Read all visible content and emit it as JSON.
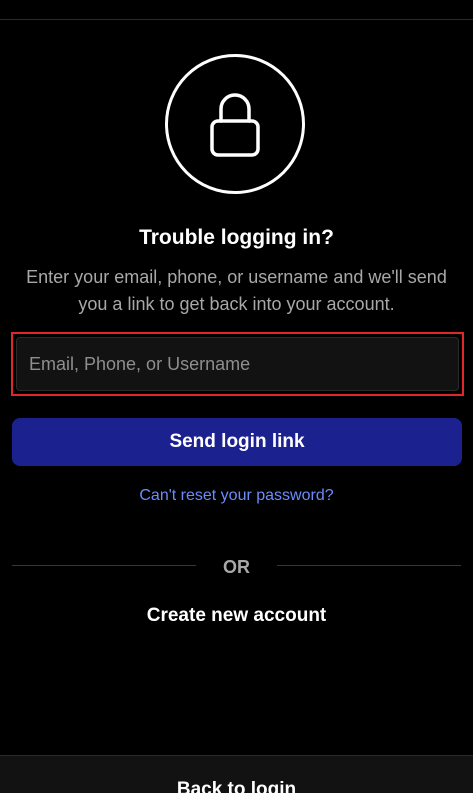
{
  "icon": "lock-icon",
  "title": "Trouble logging in?",
  "description": "Enter your email, phone, or username and we'll send you a link to get back into your account.",
  "identifier_input": {
    "placeholder": "Email, Phone, or Username",
    "value": ""
  },
  "send_button_label": "Send login link",
  "reset_link_label": "Can't reset your password?",
  "divider_label": "OR",
  "create_account_label": "Create new account",
  "back_to_login_label": "Back to login",
  "colors": {
    "background": "#000000",
    "primary_button": "#1c2190",
    "link": "#6b8cff",
    "input_focus_outline": "#e0272b"
  }
}
